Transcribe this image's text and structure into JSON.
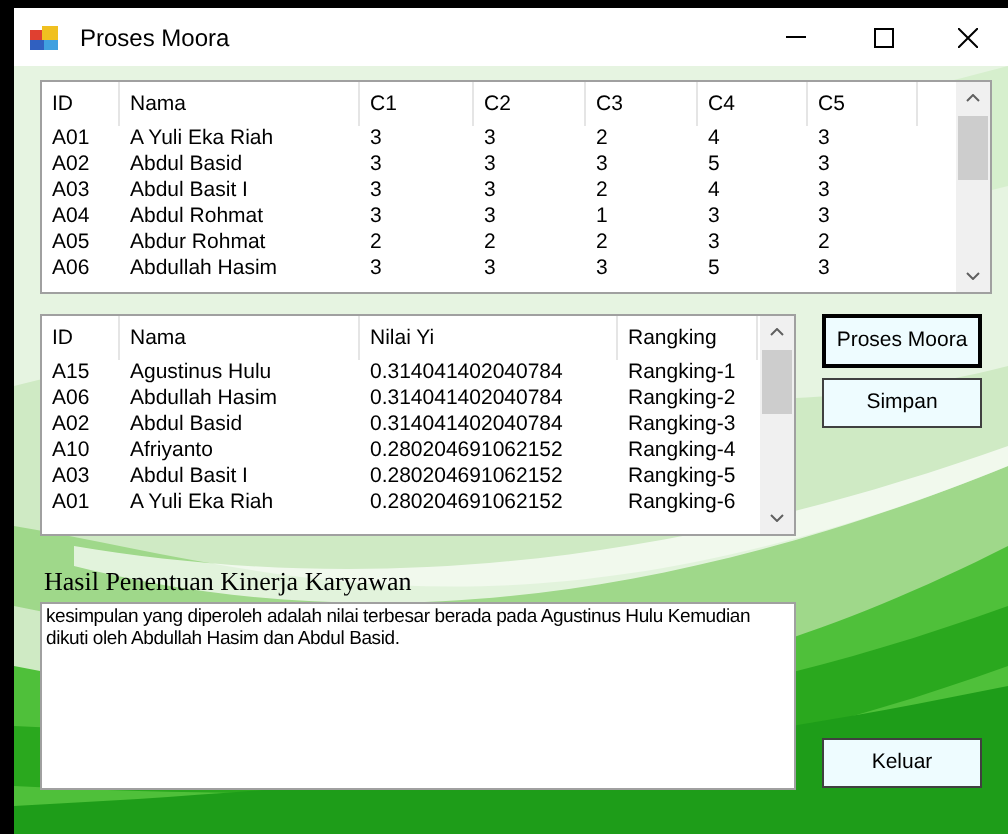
{
  "window": {
    "title": "Proses Moora"
  },
  "criteria_table": {
    "columns": [
      "ID",
      "Nama",
      "C1",
      "C2",
      "C3",
      "C4",
      "C5"
    ],
    "rows": [
      [
        "A01",
        "A Yuli Eka Riah",
        "3",
        "3",
        "2",
        "4",
        "3"
      ],
      [
        "A02",
        "Abdul Basid",
        "3",
        "3",
        "3",
        "5",
        "3"
      ],
      [
        "A03",
        "Abdul Basit I",
        "3",
        "3",
        "2",
        "4",
        "3"
      ],
      [
        "A04",
        "Abdul Rohmat",
        "3",
        "3",
        "1",
        "3",
        "3"
      ],
      [
        "A05",
        "Abdur Rohmat",
        "2",
        "2",
        "2",
        "3",
        "2"
      ],
      [
        "A06",
        "Abdullah Hasim",
        "3",
        "3",
        "3",
        "5",
        "3"
      ]
    ]
  },
  "ranking_table": {
    "columns": [
      "ID",
      "Nama",
      "Nilai Yi",
      "Rangking"
    ],
    "rows": [
      [
        "A15",
        "Agustinus Hulu",
        "0.314041402040784",
        "Rangking-1"
      ],
      [
        "A06",
        "Abdullah Hasim",
        "0.314041402040784",
        "Rangking-2"
      ],
      [
        "A02",
        "Abdul Basid",
        "0.314041402040784",
        "Rangking-3"
      ],
      [
        "A10",
        "Afriyanto",
        "0.280204691062152",
        "Rangking-4"
      ],
      [
        "A03",
        "Abdul Basit I",
        "0.280204691062152",
        "Rangking-5"
      ],
      [
        "A01",
        "A Yuli Eka Riah",
        "0.280204691062152",
        "Rangking-6"
      ]
    ]
  },
  "buttons": [
    {
      "label": "Proses Moora",
      "selected": true
    },
    {
      "label": "Simpan",
      "selected": false
    }
  ],
  "result": {
    "label": "Hasil Penentuan Kinerja Karyawan",
    "value": "kesimpulan yang diperoleh adalah nilai terbesar berada pada Agustinus Hulu Kemudian dikuti oleh Abdullah Hasim dan Abdul Basid."
  },
  "exit_button": {
    "label": "Keluar"
  }
}
